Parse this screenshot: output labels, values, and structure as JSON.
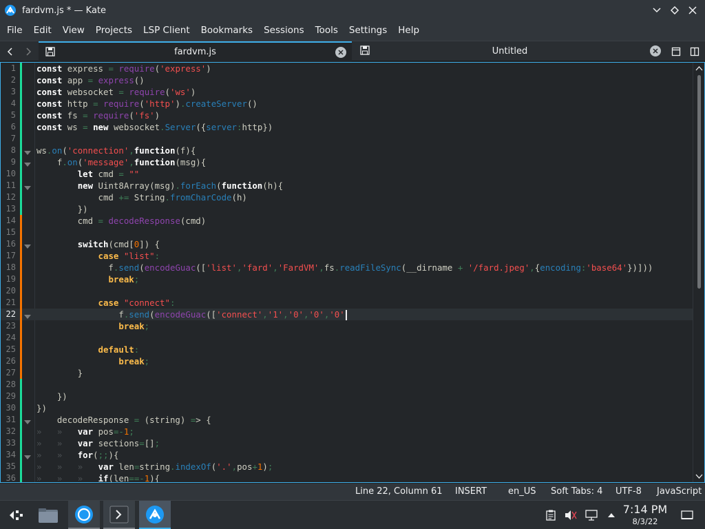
{
  "window": {
    "title": "fardvm.js * — Kate"
  },
  "menu": [
    "File",
    "Edit",
    "View",
    "Projects",
    "LSP Client",
    "Bookmarks",
    "Sessions",
    "Tools",
    "Settings",
    "Help"
  ],
  "tabs": [
    {
      "label": "fardvm.js",
      "active": true
    },
    {
      "label": "Untitled",
      "active": false
    }
  ],
  "editor": {
    "language": "JavaScript",
    "current_line": 22,
    "lines": [
      {
        "n": "1"
      },
      {
        "n": "2"
      },
      {
        "n": "3"
      },
      {
        "n": "4"
      },
      {
        "n": "5"
      },
      {
        "n": "6"
      },
      {
        "n": "7"
      },
      {
        "n": "8"
      },
      {
        "n": "9"
      },
      {
        "n": "10"
      },
      {
        "n": "11"
      },
      {
        "n": "12"
      },
      {
        "n": "13"
      },
      {
        "n": "14"
      },
      {
        "n": "15"
      },
      {
        "n": "16"
      },
      {
        "n": "17"
      },
      {
        "n": "18"
      },
      {
        "n": "19"
      },
      {
        "n": "20"
      },
      {
        "n": "21"
      },
      {
        "n": "22"
      },
      {
        "n": "23"
      },
      {
        "n": "24"
      },
      {
        "n": "25"
      },
      {
        "n": "26"
      },
      {
        "n": "27"
      },
      {
        "n": "28"
      },
      {
        "n": "29"
      },
      {
        "n": "30"
      },
      {
        "n": "31"
      },
      {
        "n": "32"
      },
      {
        "n": "33"
      },
      {
        "n": "34"
      },
      {
        "n": "35"
      },
      {
        "n": "36"
      }
    ],
    "code": [
      "const express = require('express')",
      "const app = express()",
      "const websocket = require('ws')",
      "const http = require('http').createServer()",
      "const fs = require('fs')",
      "const ws = new websocket.Server({server:http})",
      "",
      "ws.on('connection',function(f){",
      "    f.on('message',function(msg){",
      "        let cmd = \"\"",
      "        new Uint8Array(msg).forEach(function(h){",
      "            cmd += String.fromCharCode(h)",
      "        })",
      "        cmd = decodeResponse(cmd)",
      "",
      "        switch(cmd[0]) {",
      "            case \"list\":",
      "              f.send(encodeGuac(['list','fard','FardVM',fs.readFileSync(__dirname + '/fard.jpeg',{encoding:'base64'})]))",
      "              break;",
      "",
      "            case \"connect\":",
      "                f.send(encodeGuac(['connect','1','0','0','0'",
      "                break;",
      "",
      "            default:",
      "                break;",
      "        }",
      "",
      "    })",
      "})",
      "    decodeResponse = (string) => {",
      "        var pos=-1;",
      "        var sections=[];",
      "        for(;;){",
      "            var len=string.indexOf('.',pos+1);",
      "            if(len==-1){"
    ]
  },
  "status": {
    "position": "Line 22, Column 61",
    "mode": "INSERT",
    "dictionary": "en_US",
    "indent": "Soft Tabs: 4",
    "encoding": "UTF-8",
    "language": "JavaScript"
  },
  "taskbar": {
    "time": "7:14 PM",
    "date": "8/3/22"
  }
}
